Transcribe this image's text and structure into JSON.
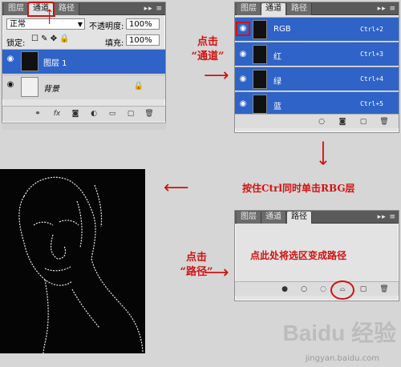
{
  "layers_panel": {
    "tabs": [
      "图层",
      "通道",
      "路径"
    ],
    "blend_mode": "正常",
    "opacity_label": "不透明度:",
    "opacity_value": "100%",
    "lock_label": "锁定:",
    "fill_label": "填充:",
    "fill_value": "100%",
    "layers": [
      {
        "name": "图层 1",
        "selected": true
      },
      {
        "name": "背景",
        "selected": false
      }
    ]
  },
  "channels_panel": {
    "tabs": [
      "图层",
      "通道",
      "路径"
    ],
    "channels": [
      {
        "name": "RGB",
        "shortcut": "Ctrl+2"
      },
      {
        "name": "红",
        "shortcut": "Ctrl+3"
      },
      {
        "name": "绿",
        "shortcut": "Ctrl+4"
      },
      {
        "name": "蓝",
        "shortcut": "Ctrl+5"
      }
    ]
  },
  "paths_panel": {
    "tabs": [
      "图层",
      "通道",
      "路径"
    ]
  },
  "annotations": {
    "click_channels": "点击\n“通道”",
    "ctrl_click": "按住Ctrl同时单击RBG层",
    "click_paths": "点击\n“路径”",
    "make_path": "点此处将选区变成路径"
  },
  "watermark": {
    "brand": "Baidu 经验",
    "url": "jingyan.baidu.com"
  },
  "colors": {
    "selection_blue": "#2f63c8",
    "annotation_red": "#d11111",
    "tab_dark": "#5a5a5a"
  },
  "icons": {
    "visibility": "eye-icon",
    "menu": "panel-menu-icon",
    "link": "link-icon",
    "fx": "fx-icon",
    "mask": "mask-icon",
    "adjustment": "adjustment-icon",
    "group": "folder-icon",
    "new": "new-layer-icon",
    "trash": "trash-icon",
    "path": "make-work-path-icon"
  }
}
